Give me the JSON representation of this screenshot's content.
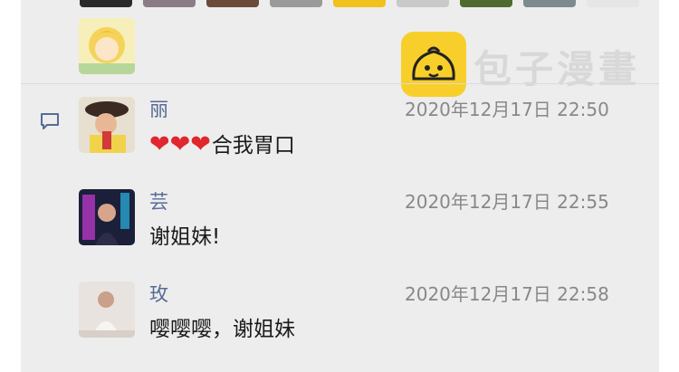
{
  "watermark": {
    "text": "包子漫畫"
  },
  "comments": [
    {
      "name": "丽",
      "time": "2020年12月17日 22:50",
      "text": "合我胃口",
      "hearts": "❤❤❤"
    },
    {
      "name": "芸",
      "time": "2020年12月17日 22:55",
      "text": "谢姐妹!"
    },
    {
      "name": "玫",
      "time": "2020年12月17日 22:58",
      "text": "嘤嘤嘤，谢姐妹"
    }
  ],
  "colors": {
    "panel": "#ededed",
    "name": "#576b95",
    "heart": "#e0262e",
    "logo": "#f8cf2a"
  },
  "icons": {
    "comment": "comment-bubble-icon"
  }
}
